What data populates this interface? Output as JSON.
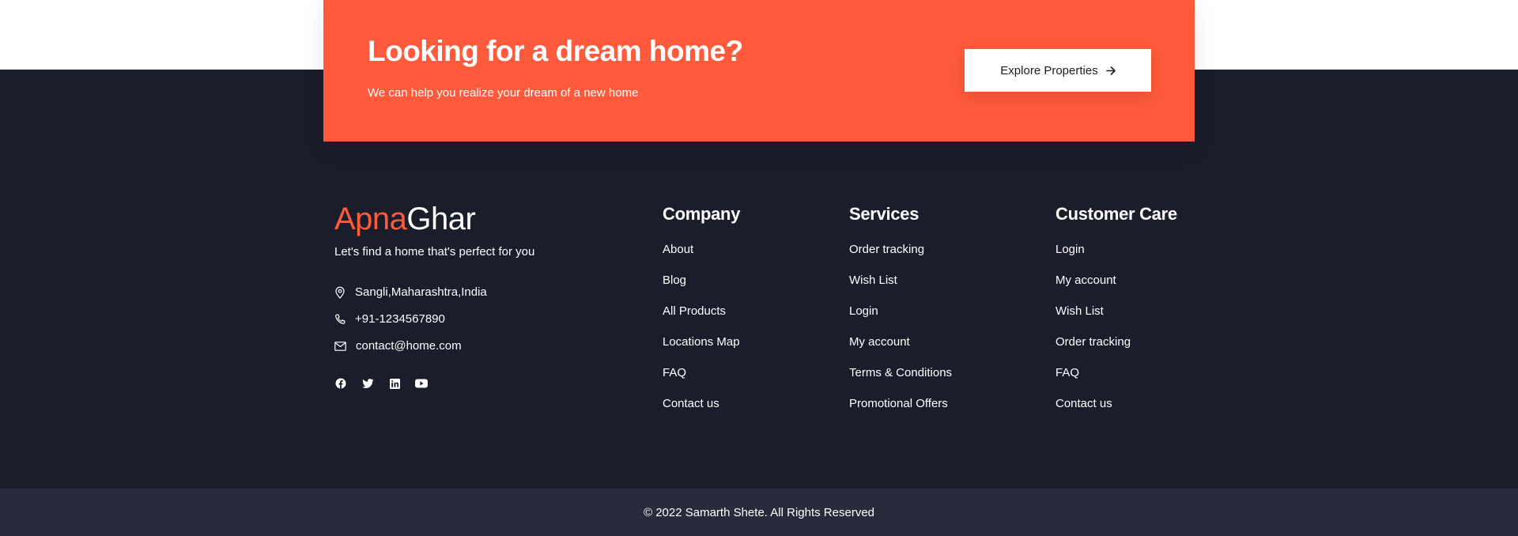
{
  "cta": {
    "title": "Looking for a dream home?",
    "subtitle": "We can help you realize your dream of a new home",
    "button_label": "Explore Properties",
    "button_icon": "arrow-right-icon"
  },
  "brand": {
    "part1": "Apna",
    "part2": "Ghar",
    "tagline": "Let's find a home that's perfect for you",
    "accent_color": "#fe5a3b"
  },
  "contact": {
    "address": "Sangli,Maharashtra,India",
    "phone": "+91-1234567890",
    "email": "contact@home.com"
  },
  "social": [
    "facebook-icon",
    "twitter-icon",
    "linkedin-icon",
    "youtube-icon"
  ],
  "columns": [
    {
      "title": "Company",
      "items": [
        "About",
        "Blog",
        "All Products",
        "Locations Map",
        "FAQ",
        "Contact us"
      ]
    },
    {
      "title": "Services",
      "items": [
        "Order tracking",
        "Wish List",
        "Login",
        "My account",
        "Terms & Conditions",
        "Promotional Offers"
      ]
    },
    {
      "title": "Customer Care",
      "items": [
        "Login",
        "My account",
        "Wish List",
        "Order tracking",
        "FAQ",
        "Contact us"
      ]
    }
  ],
  "copyright": "© 2022 Samarth Shete. All Rights Reserved",
  "colors": {
    "footer_bg": "#1b1d2b",
    "bottom_bar_bg": "#282b3b",
    "cta_bg": "#fe5a3b"
  }
}
